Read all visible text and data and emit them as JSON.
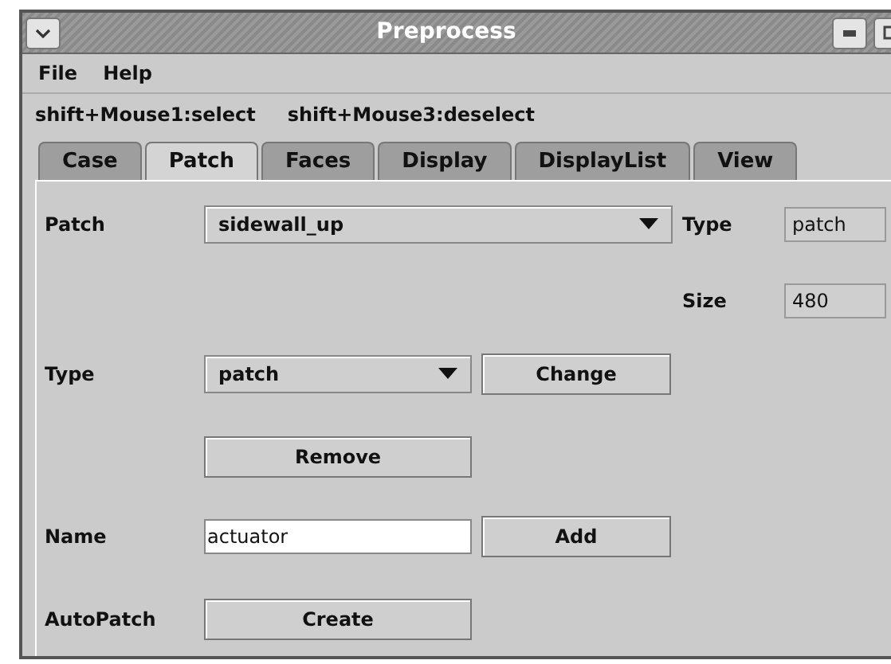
{
  "window": {
    "title": "Preprocess"
  },
  "menu": [
    "File",
    "Help"
  ],
  "hints": [
    "shift+Mouse1:select",
    "shift+Mouse3:deselect"
  ],
  "tabs": [
    {
      "label": "Case",
      "selected": false
    },
    {
      "label": "Patch",
      "selected": true
    },
    {
      "label": "Faces",
      "selected": false
    },
    {
      "label": "Display",
      "selected": false
    },
    {
      "label": "DisplayList",
      "selected": false
    },
    {
      "label": "View",
      "selected": false
    }
  ],
  "patch": {
    "label": "Patch",
    "value": "sidewall_up",
    "type_label": "Type",
    "type_value": "patch",
    "size_label": "Size",
    "size_value": "480"
  },
  "type": {
    "label": "Type",
    "value": "patch",
    "button": "Change"
  },
  "remove": {
    "button": "Remove"
  },
  "name": {
    "label": "Name",
    "value": "actuator",
    "button": "Add"
  },
  "autopatch": {
    "label": "AutoPatch",
    "button": "Create"
  }
}
